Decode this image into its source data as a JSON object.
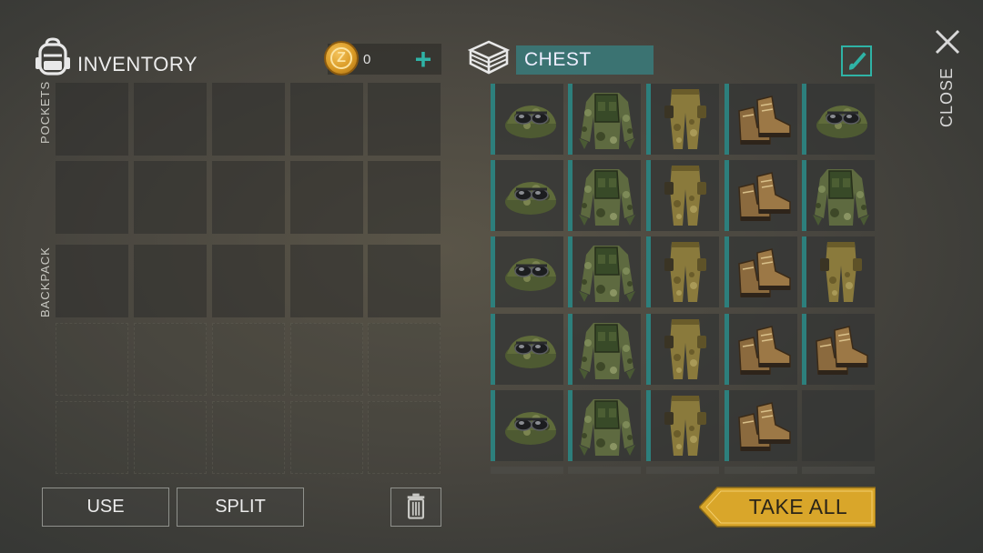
{
  "inventory": {
    "title": "INVENTORY",
    "coins": "0",
    "pockets_label": "POCKETS",
    "backpack_label": "BACKPACK"
  },
  "chest": {
    "title": "CHEST",
    "items": [
      [
        "cap",
        "jacket",
        "pants",
        "boots",
        "cap"
      ],
      [
        "cap",
        "jacket",
        "pants",
        "boots",
        "jacket"
      ],
      [
        "cap",
        "jacket",
        "pants",
        "boots",
        "pants"
      ],
      [
        "cap",
        "jacket",
        "pants",
        "boots",
        "boots"
      ],
      [
        "cap",
        "jacket",
        "pants",
        "boots",
        "empty"
      ]
    ]
  },
  "close_label": "CLOSE",
  "buttons": {
    "use": "USE",
    "split": "SPLIT",
    "take_all": "TAKE ALL"
  },
  "icons": {
    "backpack": "backpack-icon",
    "coin": "coin-icon",
    "add": "plus-icon",
    "chest": "chest-icon",
    "sort": "sort-brush-icon",
    "close": "close-icon",
    "trash": "trash-icon"
  },
  "colors": {
    "accent": "#2fb3a6",
    "chest_header": "#3b7372",
    "slot_bar": "#2d7f7c",
    "take_all": "#d9a62a"
  }
}
